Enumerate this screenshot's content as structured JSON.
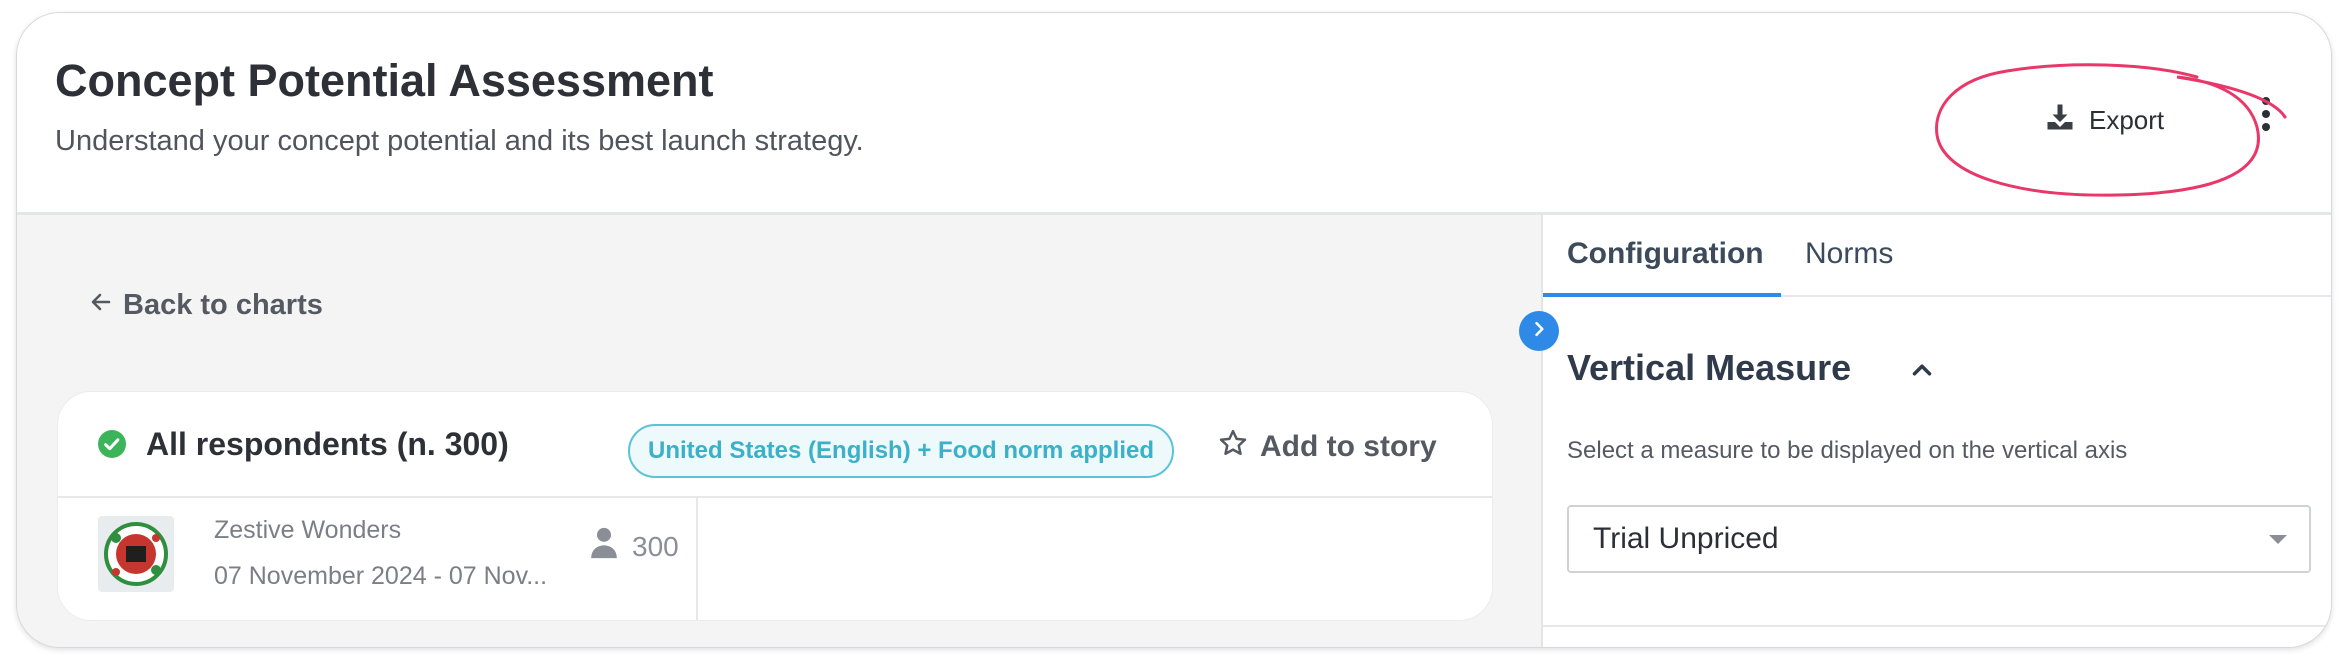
{
  "header": {
    "title": "Concept Potential Assessment",
    "subtitle": "Understand your concept potential and its best launch strategy.",
    "export_label": "Export",
    "export_icon": "download-icon",
    "more_icon": "kebab-menu-icon",
    "annotation_color": "#e8386a"
  },
  "left": {
    "back_label": "Back to charts",
    "card": {
      "title": "All respondents (n. 300)",
      "norm_badge": "United States (English) + Food norm applied",
      "add_story_label": "Add to story",
      "concept": {
        "name": "Zestive Wonders",
        "dates": "07 November 2024 - 07 Nov...",
        "respondents": "300"
      }
    }
  },
  "right": {
    "tabs": [
      {
        "label": "Configuration",
        "active": true
      },
      {
        "label": "Norms",
        "active": false
      }
    ],
    "section_title": "Vertical Measure",
    "section_help": "Select a measure to be displayed on the vertical axis",
    "select_value": "Trial Unpriced"
  },
  "colors": {
    "accent": "#2e8ae6",
    "success": "#3cb55a",
    "badge_border": "#5cc3d6",
    "badge_text": "#3bb0c9"
  }
}
